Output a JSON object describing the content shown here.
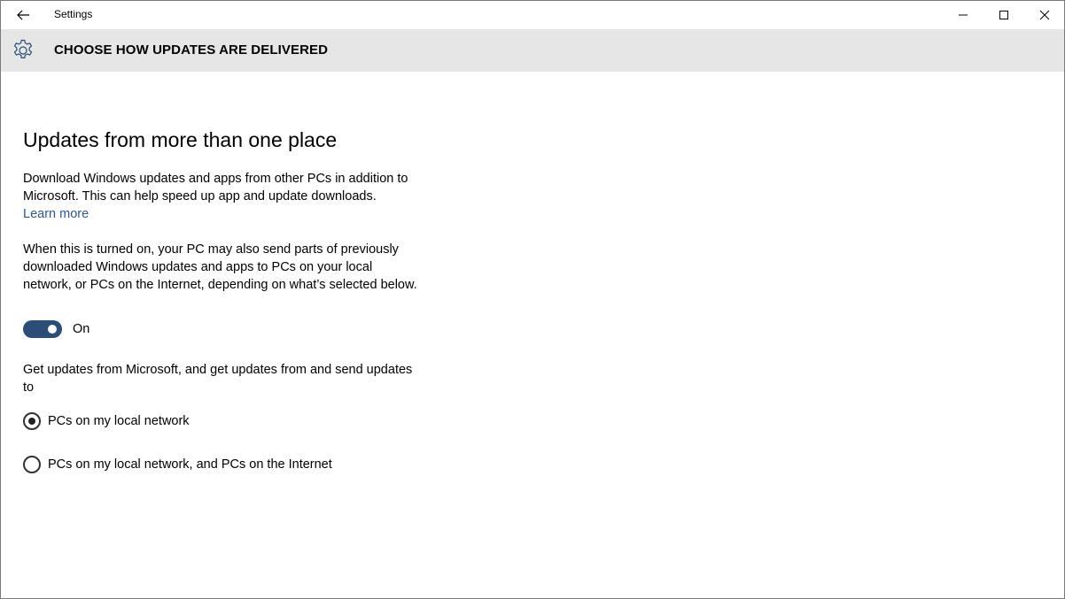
{
  "window": {
    "title": "Settings"
  },
  "header": {
    "title": "CHOOSE HOW UPDATES ARE DELIVERED",
    "icon": "gear-icon"
  },
  "content": {
    "heading": "Updates from more than one place",
    "description": "Download Windows updates and apps from other PCs in addition to Microsoft. This can help speed up app and update downloads.",
    "learn_more": "Learn more",
    "toggle_description": "When this is turned on, your PC may also send parts of previously downloaded Windows updates and apps to PCs on your local network, or PCs on the Internet, depending on what’s selected below.",
    "toggle": {
      "state": "on",
      "label": "On"
    },
    "options_intro": "Get updates from Microsoft, and get updates from and send updates to",
    "options": [
      {
        "label": "PCs on my local network",
        "selected": true
      },
      {
        "label": "PCs on my local network, and PCs on the Internet",
        "selected": false
      }
    ]
  },
  "colors": {
    "accent": "#2b4e78",
    "link": "#2b5797",
    "header_bg": "#e6e6e6"
  }
}
